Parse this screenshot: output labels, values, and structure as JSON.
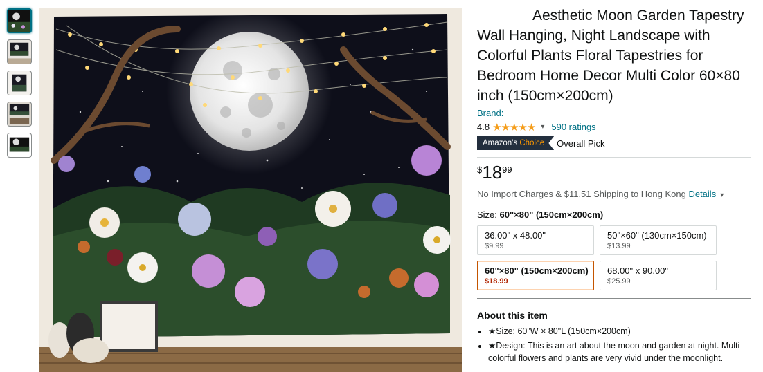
{
  "thumbnails": [
    {
      "label": "thumbnail-1",
      "active": true
    },
    {
      "label": "thumbnail-2",
      "active": false
    },
    {
      "label": "thumbnail-3",
      "active": false
    },
    {
      "label": "thumbnail-4",
      "active": false
    },
    {
      "label": "thumbnail-5",
      "active": false
    }
  ],
  "product": {
    "title": "Aesthetic Moon Garden Tapestry Wall Hanging, Night Landscape with Colorful Plants Floral Tapestries for Bedroom Home Decor Multi Color 60×80 inch (150cm×200cm)",
    "brand_label": "Brand:",
    "rating_value": "4.8",
    "stars": "★★★★★",
    "ratings_count": "590 ratings",
    "badge_prefix": "Amazon's ",
    "badge_suffix": "Choice",
    "badge_note": "Overall Pick"
  },
  "price": {
    "symbol": "$",
    "whole": "18",
    "fraction": "99"
  },
  "shipping": {
    "text": "No Import Charges & $11.51 Shipping to Hong Kong ",
    "details": "Details"
  },
  "size": {
    "label": "Size: ",
    "selected": "60\"×80\" (150cm×200cm)",
    "options": [
      {
        "name": "36.00\" x 48.00\"",
        "price": "$9.99"
      },
      {
        "name": "50\"×60\" (130cm×150cm)",
        "price": "$13.99"
      },
      {
        "name": "60\"×80\" (150cm×200cm)",
        "price": "$18.99"
      },
      {
        "name": "68.00\" x 90.00\"",
        "price": "$25.99"
      }
    ]
  },
  "about": {
    "heading": "About this item",
    "bullets": [
      "★Size: 60\"W × 80\"L (150cm×200cm)",
      "★Design: This is an art about the moon and garden at night. Multi colorful flowers and plants are very vivid under the moonlight."
    ]
  },
  "colors": {
    "link": "#007185",
    "star": "#f59d1a",
    "badge_bg": "#232f3e",
    "price_red": "#b12704",
    "selected_border": "#c45500"
  },
  "icons": {
    "share": "share-icon",
    "chevron": "chevron-down-icon"
  }
}
